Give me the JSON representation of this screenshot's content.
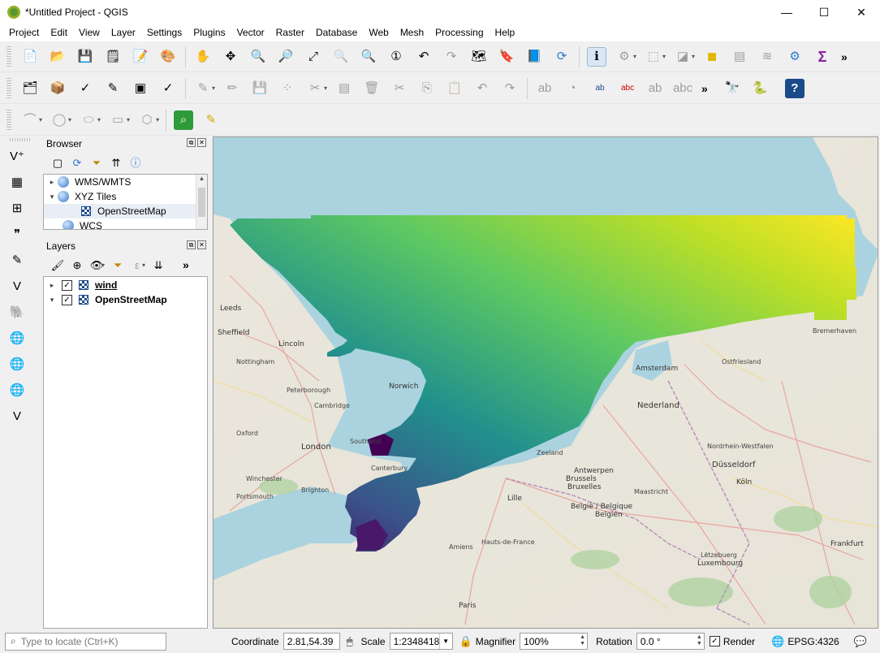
{
  "window": {
    "title": "*Untitled Project - QGIS",
    "minimize": "—",
    "maximize": "☐",
    "close": "✕"
  },
  "menu": [
    "Project",
    "Edit",
    "View",
    "Layer",
    "Settings",
    "Plugins",
    "Vector",
    "Raster",
    "Database",
    "Web",
    "Mesh",
    "Processing",
    "Help"
  ],
  "browser": {
    "title": "Browser",
    "items": [
      {
        "label": "WMS/WMTS",
        "arrow": "▸",
        "icon": "globe"
      },
      {
        "label": "XYZ Tiles",
        "arrow": "▾",
        "icon": "globe"
      },
      {
        "label": "OpenStreetMap",
        "arrow": "",
        "icon": "raster"
      },
      {
        "label": "WCS",
        "arrow": "",
        "icon": "globe"
      }
    ]
  },
  "layers": {
    "title": "Layers",
    "items": [
      {
        "label": "wind",
        "arrow": "▸",
        "checked": "✓"
      },
      {
        "label": "OpenStreetMap",
        "arrow": "▾",
        "checked": "✓"
      }
    ]
  },
  "toolbar_more": "»",
  "map": {
    "places": [
      {
        "name": "Leeds"
      },
      {
        "name": "Sheffield"
      },
      {
        "name": "Lincoln"
      },
      {
        "name": "Nottingham"
      },
      {
        "name": "Norwich"
      },
      {
        "name": "Peterborough"
      },
      {
        "name": "Cambridge"
      },
      {
        "name": "Oxford"
      },
      {
        "name": "London"
      },
      {
        "name": "Southend"
      },
      {
        "name": "Canterbury"
      },
      {
        "name": "Winchester"
      },
      {
        "name": "Portsmouth"
      },
      {
        "name": "Brighton"
      },
      {
        "name": "Lille"
      },
      {
        "name": "Brussels"
      },
      {
        "name": "Bruxelles"
      },
      {
        "name": "België / Belgique"
      },
      {
        "name": "Belgien"
      },
      {
        "name": "Antwerpen"
      },
      {
        "name": "Nederland"
      },
      {
        "name": "Amsterdam"
      },
      {
        "name": "Zeeland"
      },
      {
        "name": "Düsseldorf"
      },
      {
        "name": "Nordrhein-Westfalen"
      },
      {
        "name": "Köln"
      },
      {
        "name": "Bremerhaven"
      },
      {
        "name": "Amiens"
      },
      {
        "name": "Paris"
      },
      {
        "name": "Luxembourg"
      },
      {
        "name": "Lëtzebuerg"
      },
      {
        "name": "Frankfurt"
      },
      {
        "name": "Hauts-de-France"
      },
      {
        "name": "Maastricht"
      },
      {
        "name": "Ostfriesland"
      }
    ]
  },
  "status": {
    "locate_placeholder": "Type to locate (Ctrl+K)",
    "coordinate_label": "Coordinate",
    "coordinate_value": "2.81,54.39",
    "scale_label": "Scale",
    "scale_value": "1:2348418",
    "magnifier_label": "Magnifier",
    "magnifier_value": "100%",
    "rotation_label": "Rotation",
    "rotation_value": "0.0 °",
    "render_label": "Render",
    "render_checked": "✓",
    "crs": "EPSG:4326"
  }
}
